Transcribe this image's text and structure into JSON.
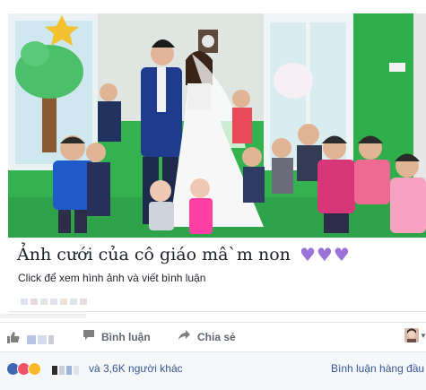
{
  "post": {
    "caption_title": "Ảnh cưới của cô giáo mâ`m non",
    "hearts": [
      "purple-heart",
      "purple-heart",
      "purple-heart"
    ],
    "caption_sub": "Click để xem hình ảnh và viết bình luận"
  },
  "actions": {
    "comment_label": "Bình luận",
    "share_label": "Chia sẻ"
  },
  "reactions": {
    "others_text": "và 3,6K người khác",
    "top_comments_label": "Bình luận hàng đầu"
  },
  "colors": {
    "link": "#365899",
    "heart": "#9b72d8",
    "muted": "#606770",
    "like_blue": "#4267b2"
  }
}
